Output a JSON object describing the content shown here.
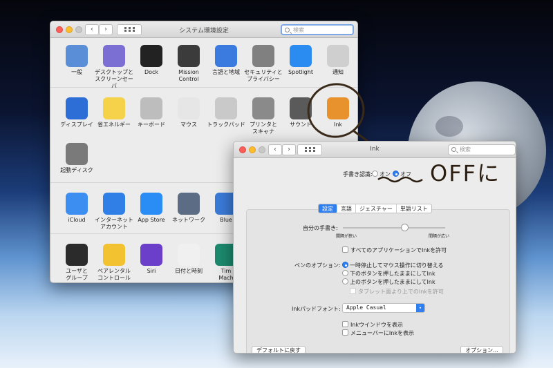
{
  "desktop": {},
  "win1": {
    "title": "システム環境設定",
    "search_placeholder": "検索",
    "row1": [
      {
        "label": "一般",
        "icon": "general-icon",
        "color": "#5a8fd8"
      },
      {
        "label": "デスクトップと\nスクリーンセーバ",
        "icon": "desktop-icon",
        "color": "#7b6fd4"
      },
      {
        "label": "Dock",
        "icon": "dock-icon",
        "color": "#222222"
      },
      {
        "label": "Mission\nControl",
        "icon": "mission-control-icon",
        "color": "#3b3b3b"
      },
      {
        "label": "言語と地域",
        "icon": "flag-icon",
        "color": "#3b7be0"
      },
      {
        "label": "セキュリティと\nプライバシー",
        "icon": "house-lock-icon",
        "color": "#808080"
      },
      {
        "label": "Spotlight",
        "icon": "spotlight-icon",
        "color": "#2a8cf0"
      },
      {
        "label": "通知",
        "icon": "notification-icon",
        "color": "#cfcfcf"
      }
    ],
    "row2": [
      {
        "label": "ディスプレイ",
        "icon": "display-icon",
        "color": "#2d6ed6"
      },
      {
        "label": "省エネルギー",
        "icon": "bulb-icon",
        "color": "#f6d24a"
      },
      {
        "label": "キーボード",
        "icon": "keyboard-icon",
        "color": "#bdbdbd"
      },
      {
        "label": "マウス",
        "icon": "mouse-icon",
        "color": "#e6e6e6"
      },
      {
        "label": "トラックパッド",
        "icon": "trackpad-icon",
        "color": "#c9c9c9"
      },
      {
        "label": "プリンタと\nスキャナ",
        "icon": "printer-icon",
        "color": "#8a8a8a"
      },
      {
        "label": "サウンド",
        "icon": "speaker-icon",
        "color": "#5a5a5a"
      },
      {
        "label": "Ink",
        "icon": "ink-icon",
        "color": "#e8922e"
      }
    ],
    "row3": [
      {
        "label": "起動ディスク",
        "icon": "disk-icon",
        "color": "#7a7a7a"
      }
    ],
    "row4": [
      {
        "label": "iCloud",
        "icon": "cloud-icon",
        "color": "#3c8ef0"
      },
      {
        "label": "インターネット\nアカウント",
        "icon": "at-icon",
        "color": "#2f7fe6"
      },
      {
        "label": "App Store",
        "icon": "app-store-icon",
        "color": "#2a8cf5"
      },
      {
        "label": "ネットワーク",
        "icon": "network-icon",
        "color": "#5c6c84"
      },
      {
        "label": "Blue",
        "icon": "bluetooth-icon",
        "color": "#3a7bd8"
      }
    ],
    "row5": [
      {
        "label": "ユーザと\nグループ",
        "icon": "users-icon",
        "color": "#2b2b2b"
      },
      {
        "label": "ペアレンタル\nコントロール",
        "icon": "parental-icon",
        "color": "#f2c230"
      },
      {
        "label": "Siri",
        "icon": "siri-icon",
        "color": "#6b3fc9"
      },
      {
        "label": "日付と時刻",
        "icon": "clock-icon",
        "color": "#f0f0f0"
      },
      {
        "label": "Tim\nMach",
        "icon": "time-machine-icon",
        "color": "#1c8a6e"
      }
    ]
  },
  "win2": {
    "title": "Ink",
    "search_placeholder": "検索",
    "handwriting_label": "手書き認識:",
    "on_label": "オン",
    "off_label": "オフ",
    "tabs": [
      "設定",
      "言語",
      "ジェスチャー",
      "単語リスト"
    ],
    "my_handwriting_label": "自分の手書き:",
    "slider_left": "間隔が狭い",
    "slider_right": "間隔が広い",
    "slider_value": 0.6,
    "allow_all_apps": "すべてのアプリケーションでInkを許可",
    "pen_options_label": "ペンのオプション:",
    "pen_opt1": "一時停止してマウス操作に切り替える",
    "pen_opt2": "下のボタンを押したままにしてInk",
    "pen_opt3": "上のボタンを押したままにしてInk",
    "pen_opt4": "タブレット面より上でのInkを許可",
    "font_label": "Inkパッドフォント:",
    "font_value": "Apple Casual",
    "show_window": "Inkウインドウを表示",
    "show_menubar": "メニューバーにInkを表示",
    "defaults_button": "デフォルトに戻す",
    "options_button": "オプション..."
  },
  "annotation": {
    "text": "OFFに"
  }
}
